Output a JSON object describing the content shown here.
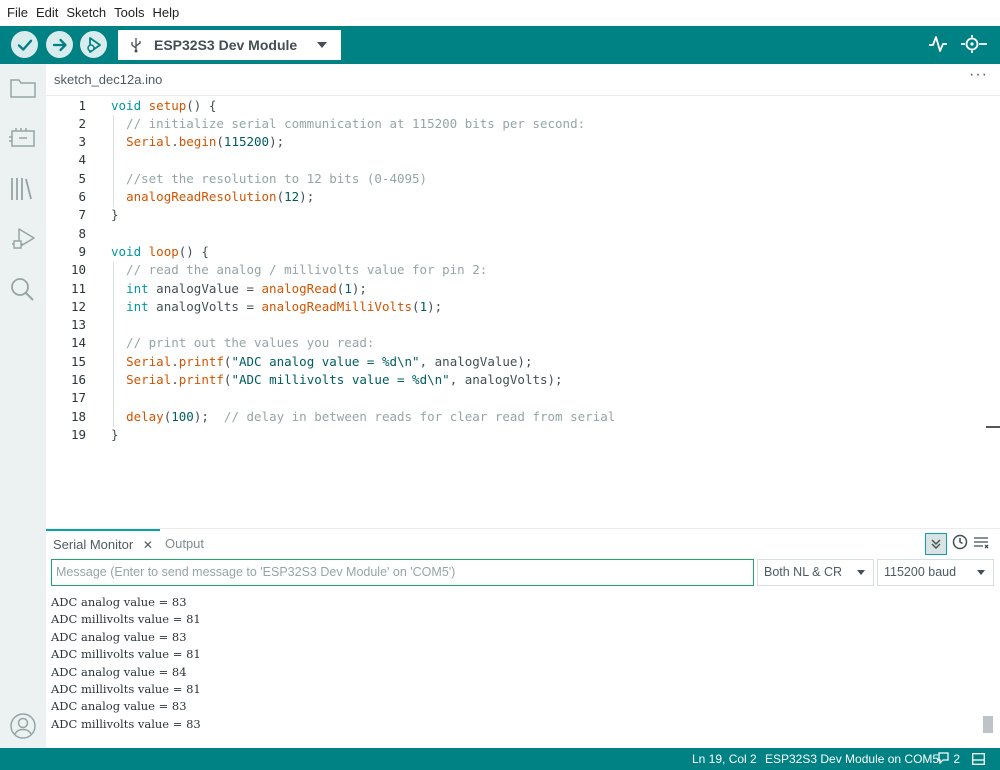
{
  "menu": [
    "File",
    "Edit",
    "Sketch",
    "Tools",
    "Help"
  ],
  "toolbar": {
    "board_name": "ESP32S3 Dev Module"
  },
  "editor": {
    "tab_name": "sketch_dec12a.ino",
    "more_label": "···",
    "line_numbers": [
      "1",
      "2",
      "3",
      "4",
      "5",
      "6",
      "7",
      "8",
      "9",
      "10",
      "11",
      "12",
      "13",
      "14",
      "15",
      "16",
      "17",
      "18",
      "19"
    ],
    "lines": [
      [
        {
          "t": "kw",
          "v": "void"
        },
        {
          "t": "pl",
          "v": " "
        },
        {
          "t": "fn",
          "v": "setup"
        },
        {
          "t": "pl",
          "v": "() {"
        }
      ],
      [
        {
          "t": "cm",
          "v": "  // initialize serial communication at 115200 bits per second:"
        }
      ],
      [
        {
          "t": "pl",
          "v": "  "
        },
        {
          "t": "fn",
          "v": "Serial"
        },
        {
          "t": "pl",
          "v": "."
        },
        {
          "t": "fn",
          "v": "begin"
        },
        {
          "t": "pl",
          "v": "("
        },
        {
          "t": "num",
          "v": "115200"
        },
        {
          "t": "pl",
          "v": ");"
        }
      ],
      [
        {
          "t": "pl",
          "v": ""
        }
      ],
      [
        {
          "t": "cm",
          "v": "  //set the resolution to 12 bits (0-4095)"
        }
      ],
      [
        {
          "t": "pl",
          "v": "  "
        },
        {
          "t": "fn",
          "v": "analogReadResolution"
        },
        {
          "t": "pl",
          "v": "("
        },
        {
          "t": "num",
          "v": "12"
        },
        {
          "t": "pl",
          "v": ");"
        }
      ],
      [
        {
          "t": "pl",
          "v": "}"
        }
      ],
      [
        {
          "t": "pl",
          "v": ""
        }
      ],
      [
        {
          "t": "kw",
          "v": "void"
        },
        {
          "t": "pl",
          "v": " "
        },
        {
          "t": "fn",
          "v": "loop"
        },
        {
          "t": "pl",
          "v": "() {"
        }
      ],
      [
        {
          "t": "cm",
          "v": "  // read the analog / millivolts value for pin 2:"
        }
      ],
      [
        {
          "t": "pl",
          "v": "  "
        },
        {
          "t": "kw",
          "v": "int"
        },
        {
          "t": "pl",
          "v": " analogValue = "
        },
        {
          "t": "fn",
          "v": "analogRead"
        },
        {
          "t": "pl",
          "v": "("
        },
        {
          "t": "num",
          "v": "1"
        },
        {
          "t": "pl",
          "v": ");"
        }
      ],
      [
        {
          "t": "pl",
          "v": "  "
        },
        {
          "t": "kw",
          "v": "int"
        },
        {
          "t": "pl",
          "v": " analogVolts = "
        },
        {
          "t": "fn",
          "v": "analogReadMilliVolts"
        },
        {
          "t": "pl",
          "v": "("
        },
        {
          "t": "num",
          "v": "1"
        },
        {
          "t": "pl",
          "v": ");"
        }
      ],
      [
        {
          "t": "pl",
          "v": ""
        }
      ],
      [
        {
          "t": "cm",
          "v": "  // print out the values you read:"
        }
      ],
      [
        {
          "t": "pl",
          "v": "  "
        },
        {
          "t": "fn",
          "v": "Serial"
        },
        {
          "t": "pl",
          "v": "."
        },
        {
          "t": "fn",
          "v": "printf"
        },
        {
          "t": "pl",
          "v": "("
        },
        {
          "t": "str",
          "v": "\"ADC analog value = %d\\n\""
        },
        {
          "t": "pl",
          "v": ", analogValue);"
        }
      ],
      [
        {
          "t": "pl",
          "v": "  "
        },
        {
          "t": "fn",
          "v": "Serial"
        },
        {
          "t": "pl",
          "v": "."
        },
        {
          "t": "fn",
          "v": "printf"
        },
        {
          "t": "pl",
          "v": "("
        },
        {
          "t": "str",
          "v": "\"ADC millivolts value = %d\\n\""
        },
        {
          "t": "pl",
          "v": ", analogVolts);"
        }
      ],
      [
        {
          "t": "pl",
          "v": ""
        }
      ],
      [
        {
          "t": "pl",
          "v": "  "
        },
        {
          "t": "fn",
          "v": "delay"
        },
        {
          "t": "pl",
          "v": "("
        },
        {
          "t": "num",
          "v": "100"
        },
        {
          "t": "pl",
          "v": ");  "
        },
        {
          "t": "cm",
          "v": "// delay in between reads for clear read from serial"
        }
      ],
      [
        {
          "t": "pl",
          "v": "}"
        }
      ]
    ]
  },
  "panel": {
    "serial_tab": "Serial Monitor",
    "close_glyph": "✕",
    "output_tab": "Output",
    "message_placeholder": "Message (Enter to send message to 'ESP32S3 Dev Module' on 'COM5')",
    "line_ending": "Both NL & CR",
    "baud": "115200 baud",
    "serial_lines": [
      "ADC analog value = 83",
      "ADC millivolts value = 81",
      "ADC analog value = 83",
      "ADC millivolts value = 81",
      "ADC analog value = 84",
      "ADC millivolts value = 81",
      "ADC analog value = 83",
      "ADC millivolts value = 83"
    ]
  },
  "status": {
    "position": "Ln 19, Col 2",
    "board_port": "ESP32S3 Dev Module on COM5",
    "notifications": "2"
  },
  "colors": {
    "teal": "#008184",
    "sidebar": "#ecf1f1",
    "keyword": "#00979d",
    "function": "#d35400",
    "comment": "#95a5a6"
  },
  "icons": [
    "verify-icon",
    "upload-icon",
    "debug-icon",
    "usb-icon",
    "serial-plotter-icon",
    "serial-monitor-icon",
    "folder-icon",
    "board-manager-icon",
    "library-icon",
    "debug-sidebar-icon",
    "search-icon",
    "account-icon"
  ]
}
